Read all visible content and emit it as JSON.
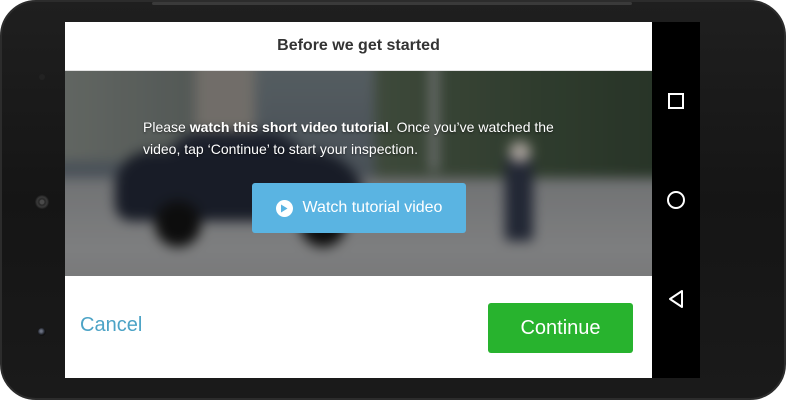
{
  "dialog": {
    "title": "Before we get started",
    "intro_prefix": "Please ",
    "intro_bold": "watch this short video tutorial",
    "intro_suffix": ". Once you’ve watched the video, tap ‘Continue’ to start your inspection.",
    "watch_button_label": "Watch tutorial video",
    "watch_button_icon": "play-circle-icon",
    "cancel_label": "Cancel",
    "continue_label": "Continue"
  },
  "navigation_bar": {
    "items": [
      {
        "name": "recents",
        "icon": "square-icon"
      },
      {
        "name": "home",
        "icon": "circle-icon"
      },
      {
        "name": "back",
        "icon": "triangle-back-icon"
      }
    ]
  },
  "colors": {
    "watch_button": "#5ab4e2",
    "continue_button": "#28b32e",
    "cancel_link": "#4ca3c6",
    "title_text": "#333333"
  }
}
